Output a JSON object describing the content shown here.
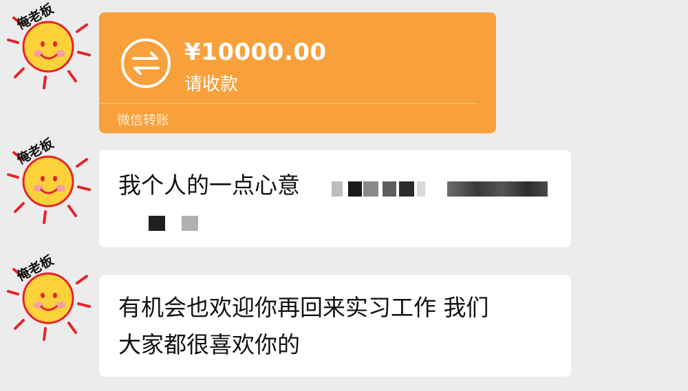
{
  "sender": {
    "name": "俺老板",
    "avatar_icon": "sun-face-icon"
  },
  "transfer": {
    "amount": "¥10000.00",
    "label": "请收款",
    "footer": "微信转账",
    "icon": "transfer-arrows-icon",
    "color": "#f8a03c"
  },
  "messages": [
    {
      "text": "我个人的一点心意",
      "redacted": true
    },
    {
      "line1": "有机会也欢迎你再回来实习工作 我们",
      "line2": "大家都很喜欢你的"
    }
  ]
}
